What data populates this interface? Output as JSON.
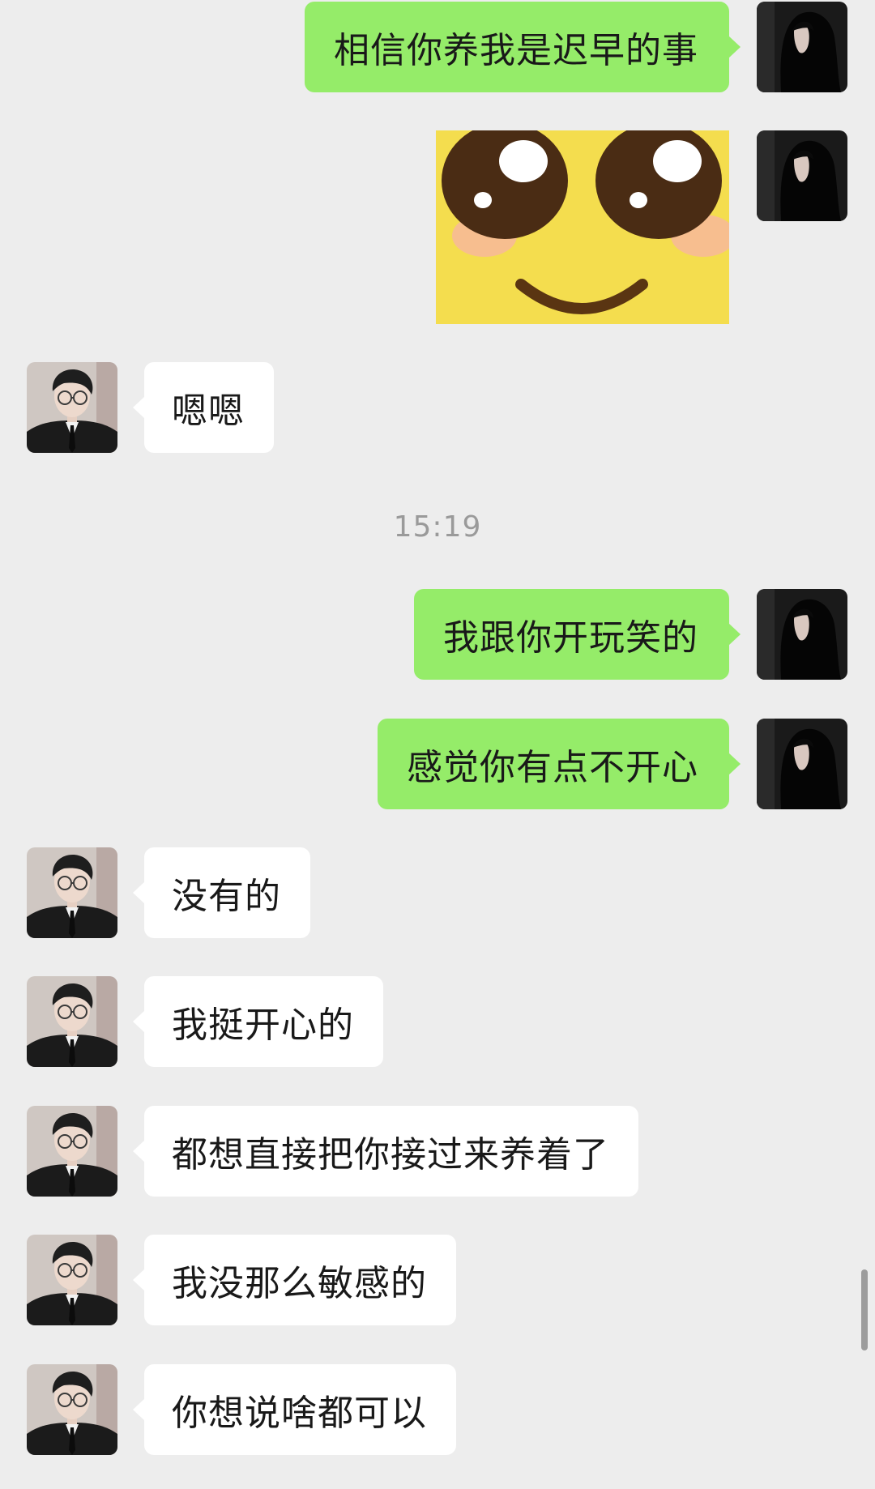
{
  "chat": {
    "time_divider": "15:19",
    "messages": [
      {
        "side": "me",
        "type": "text",
        "text": "相信你养我是迟早的事"
      },
      {
        "side": "me",
        "type": "sticker",
        "sticker": "smiling-yellow-face"
      },
      {
        "side": "peer",
        "type": "text",
        "text": "嗯嗯"
      },
      {
        "side": "me",
        "type": "text",
        "text": "我跟你开玩笑的"
      },
      {
        "side": "me",
        "type": "text",
        "text": "感觉你有点不开心"
      },
      {
        "side": "peer",
        "type": "text",
        "text": "没有的"
      },
      {
        "side": "peer",
        "type": "text",
        "text": "我挺开心的"
      },
      {
        "side": "peer",
        "type": "text",
        "text": "都想直接把你接过来养着了"
      },
      {
        "side": "peer",
        "type": "text",
        "text": "我没那么敏感的"
      },
      {
        "side": "peer",
        "type": "text",
        "text": "你想说啥都可以"
      }
    ]
  },
  "colors": {
    "background": "#ededed",
    "outgoing_bubble": "#95ec69",
    "incoming_bubble": "#ffffff",
    "timestamp_text": "#9a9a9a"
  },
  "icons": {
    "my_avatar": "avatar-dark-hair-girl",
    "peer_avatar": "avatar-man-in-suit-glasses"
  }
}
